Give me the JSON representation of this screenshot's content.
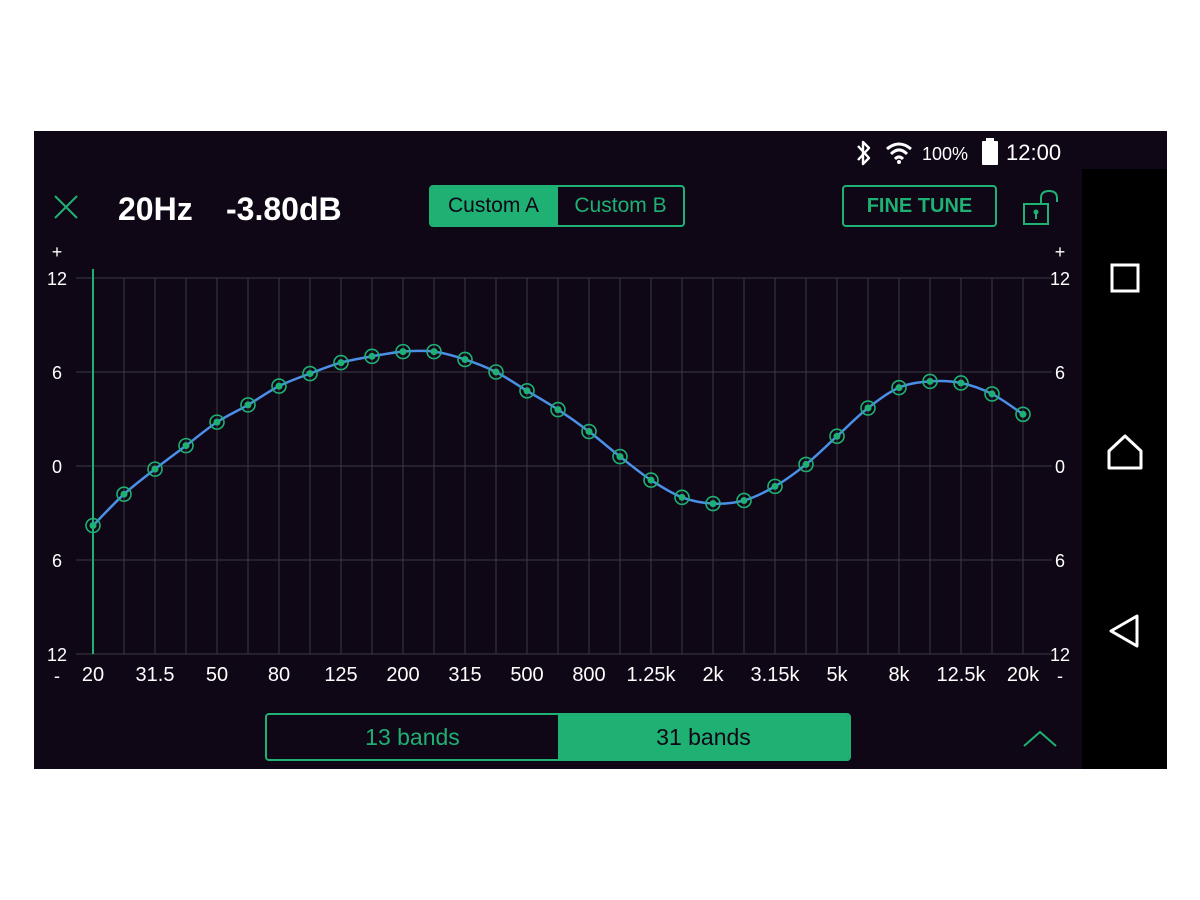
{
  "status_bar": {
    "battery_text": "100%",
    "time": "12:00",
    "icons": [
      "bluetooth-icon",
      "wifi-icon",
      "battery-icon"
    ]
  },
  "header": {
    "frequency": "20Hz",
    "gain": "-3.80dB",
    "presets": [
      "Custom A",
      "Custom B"
    ],
    "selected_preset": "Custom A",
    "fine_tune_label": "FINE TUNE",
    "lock_state": "unlocked"
  },
  "bands": {
    "options": [
      "13 bands",
      "31 bands"
    ],
    "selected": "31 bands"
  },
  "colors": {
    "background": "#0f0716",
    "accent": "#1fb073",
    "curve": "#4b8fe6",
    "grid": "#3a3a42",
    "text": "#ffffff"
  },
  "chart_data": {
    "type": "line",
    "y_axis": {
      "ylim": [
        -12,
        12
      ],
      "left_ticks": [
        "+",
        "12",
        "6",
        "0",
        "6",
        "12",
        "-"
      ],
      "right_ticks": [
        "+",
        "12",
        "6",
        "0",
        "6",
        "12",
        "-"
      ]
    },
    "x_tick_labels": [
      "20",
      "31.5",
      "50",
      "80",
      "125",
      "200",
      "315",
      "500",
      "800",
      "1.25k",
      "2k",
      "3.15k",
      "5k",
      "8k",
      "12.5k",
      "20k"
    ],
    "bands": [
      "20",
      "25",
      "31.5",
      "40",
      "50",
      "63",
      "80",
      "100",
      "125",
      "160",
      "200",
      "250",
      "315",
      "400",
      "500",
      "630",
      "800",
      "1k",
      "1.25k",
      "1.6k",
      "2k",
      "2.5k",
      "3.15k",
      "4k",
      "5k",
      "6.3k",
      "8k",
      "10k",
      "12.5k",
      "16k",
      "20k"
    ],
    "values": [
      -3.8,
      -1.8,
      -0.2,
      1.3,
      2.8,
      3.9,
      5.1,
      5.9,
      6.6,
      7.0,
      7.3,
      7.3,
      6.8,
      6.0,
      4.8,
      3.6,
      2.2,
      0.6,
      -0.9,
      -2.0,
      -2.4,
      -2.2,
      -1.3,
      0.1,
      1.9,
      3.7,
      5.0,
      5.4,
      5.3,
      4.6,
      3.3
    ],
    "selected_band": "20"
  }
}
